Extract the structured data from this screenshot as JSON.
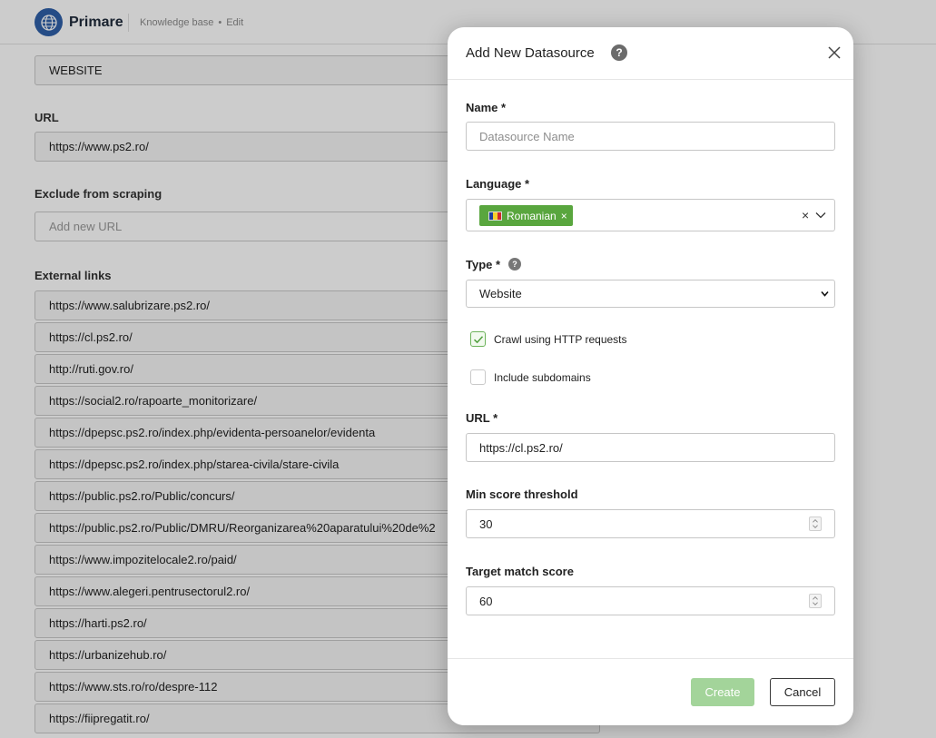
{
  "app": {
    "name": "Primare",
    "breadcrumb": [
      "Knowledge base",
      "•",
      "Edit"
    ]
  },
  "background_form": {
    "type_value": "WEBSITE",
    "url_label": "URL",
    "url_value": "https://www.ps2.ro/",
    "exclude_label": "Exclude from scraping",
    "exclude_placeholder": "Add new URL",
    "external_label": "External links",
    "external_links": [
      "https://www.salubrizare.ps2.ro/",
      "https://cl.ps2.ro/",
      "http://ruti.gov.ro/",
      "https://social2.ro/rapoarte_monitorizare/",
      "https://dpepsc.ps2.ro/index.php/evidenta-persoanelor/evidenta",
      "https://dpepsc.ps2.ro/index.php/starea-civila/stare-civila",
      "https://public.ps2.ro/Public/concurs/",
      "https://public.ps2.ro/Public/DMRU/Reorganizarea%20aparatului%20de%2",
      "https://www.impozitelocale2.ro/paid/",
      "https://www.alegeri.pentrusectorul2.ro/",
      "https://harti.ps2.ro/",
      "https://urbanizehub.ro/",
      "https://www.sts.ro/ro/despre-112",
      "https://fiipregatit.ro/"
    ]
  },
  "modal": {
    "title": "Add New Datasource",
    "help_glyph": "?",
    "name_label": "Name *",
    "name_placeholder": "Datasource Name",
    "name_value": "",
    "language_label": "Language *",
    "language_chip": "Romanian",
    "chip_remove": "×",
    "clear_all": "×",
    "type_label": "Type *",
    "type_value": "Website",
    "crawl_label": "Crawl using HTTP requests",
    "crawl_checked": true,
    "subdomains_label": "Include subdomains",
    "subdomains_checked": false,
    "url_label": "URL *",
    "url_value": "https://cl.ps2.ro/",
    "min_score_label": "Min score threshold",
    "min_score_value": "30",
    "target_score_label": "Target match score",
    "target_score_value": "60",
    "create_label": "Create",
    "cancel_label": "Cancel"
  },
  "colors": {
    "accent_green": "#59a63e",
    "create_disabled": "#a3d49a",
    "logo_blue": "#2f5fa8"
  },
  "icons": [
    "globe-icon",
    "help-icon",
    "close-icon",
    "chevron-down-icon",
    "check-icon",
    "spinner-icon",
    "flag-icon"
  ]
}
